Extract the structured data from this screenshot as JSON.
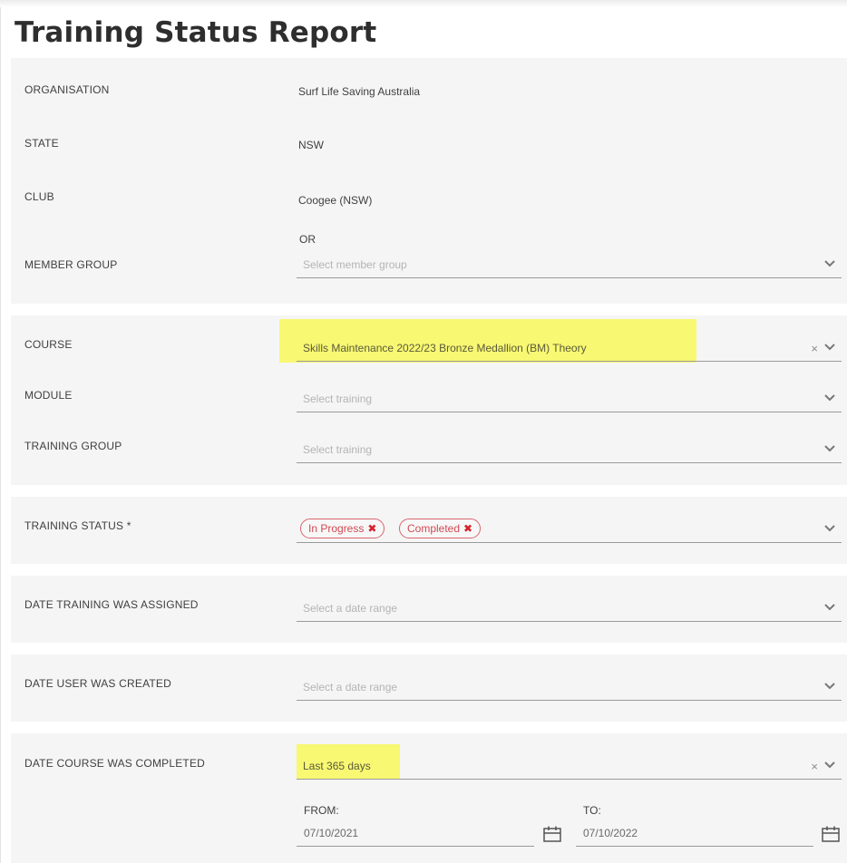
{
  "page": {
    "title": "Training Status Report"
  },
  "filters": {
    "organisation": {
      "label": "ORGANISATION",
      "value": "Surf Life Saving Australia"
    },
    "state": {
      "label": "STATE",
      "value": "NSW"
    },
    "club": {
      "label": "CLUB",
      "value": "Coogee (NSW)"
    },
    "or_text": "OR",
    "member_group": {
      "label": "MEMBER GROUP",
      "placeholder": "Select member group"
    },
    "course": {
      "label": "COURSE",
      "value": "Skills Maintenance 2022/23 Bronze Medallion (BM) Theory"
    },
    "module": {
      "label": "MODULE",
      "placeholder": "Select training"
    },
    "training_group": {
      "label": "TRAINING GROUP",
      "placeholder": "Select training"
    },
    "training_status": {
      "label": "TRAINING STATUS *",
      "chips": [
        "In Progress",
        "Completed"
      ]
    },
    "date_assigned": {
      "label": "DATE TRAINING WAS ASSIGNED",
      "placeholder": "Select a date range"
    },
    "date_user_created": {
      "label": "DATE USER WAS CREATED",
      "placeholder": "Select a date range"
    },
    "date_course_completed": {
      "label": "DATE COURSE WAS COMPLETED",
      "value": "Last 365 days",
      "from_label": "FROM:",
      "from_value": "07/10/2021",
      "to_label": "TO:",
      "to_value": "07/10/2022"
    }
  },
  "icons": {
    "clear": "×",
    "chevron": "chevron-down-icon",
    "chip_remove": "✖",
    "calendar": "calendar-icon"
  },
  "colors": {
    "highlight": "#f8f873",
    "chip_accent": "#d9656c",
    "section_bg": "#f5f5f5"
  }
}
